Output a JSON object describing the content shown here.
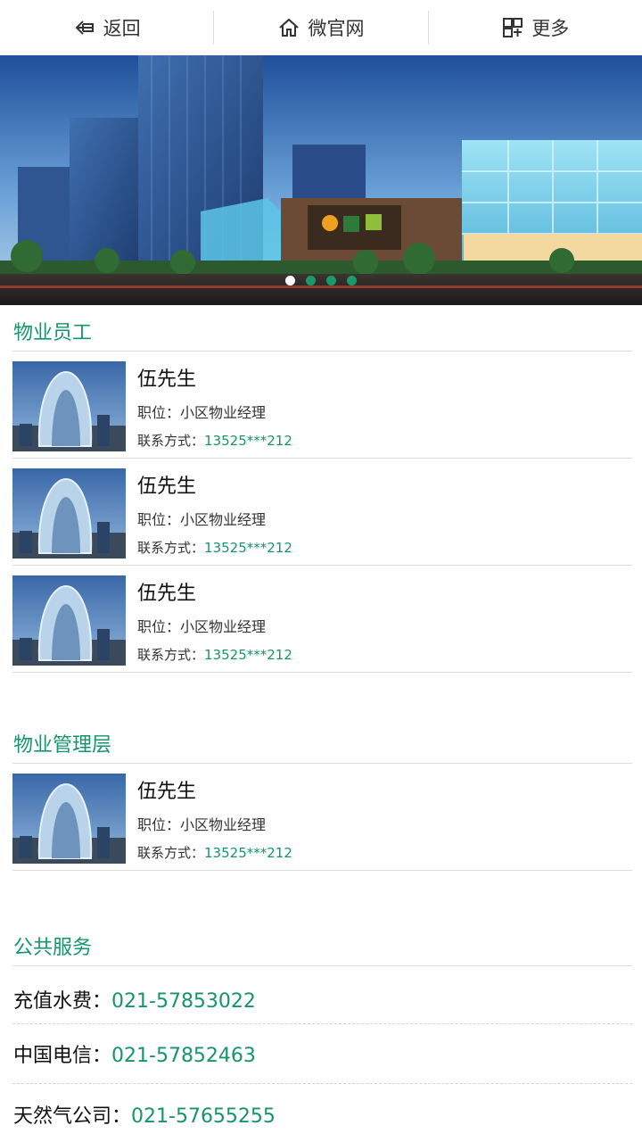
{
  "topbar": {
    "back_label": "返回",
    "home_label": "微官网",
    "more_label": "更多"
  },
  "banner": {
    "slide_count": 4,
    "active_slide": 1
  },
  "staff_section": {
    "title": "物业员工",
    "items": [
      {
        "name": "伍先生",
        "position": "职位：小区物业经理",
        "contact_label": "联系方式：",
        "phone": "13525***212"
      },
      {
        "name": "伍先生",
        "position": "职位：小区物业经理",
        "contact_label": "联系方式：",
        "phone": "13525***212"
      },
      {
        "name": "伍先生",
        "position": "职位：小区物业经理",
        "contact_label": "联系方式：",
        "phone": "13525***212"
      }
    ]
  },
  "management_section": {
    "title": "物业管理层",
    "items": [
      {
        "name": "伍先生",
        "position": "职位：小区物业经理",
        "contact_label": "联系方式：",
        "phone": "13525***212"
      }
    ]
  },
  "public_section": {
    "title": "公共服务",
    "items": [
      {
        "label": "充值水费：",
        "phone": "021-57853022"
      },
      {
        "label": "中国电信：",
        "phone": "021-57852463"
      },
      {
        "label": "天然气公司：",
        "phone": "021-57655255"
      }
    ]
  },
  "colors": {
    "accent": "#16956a",
    "divider": "#dedede"
  }
}
